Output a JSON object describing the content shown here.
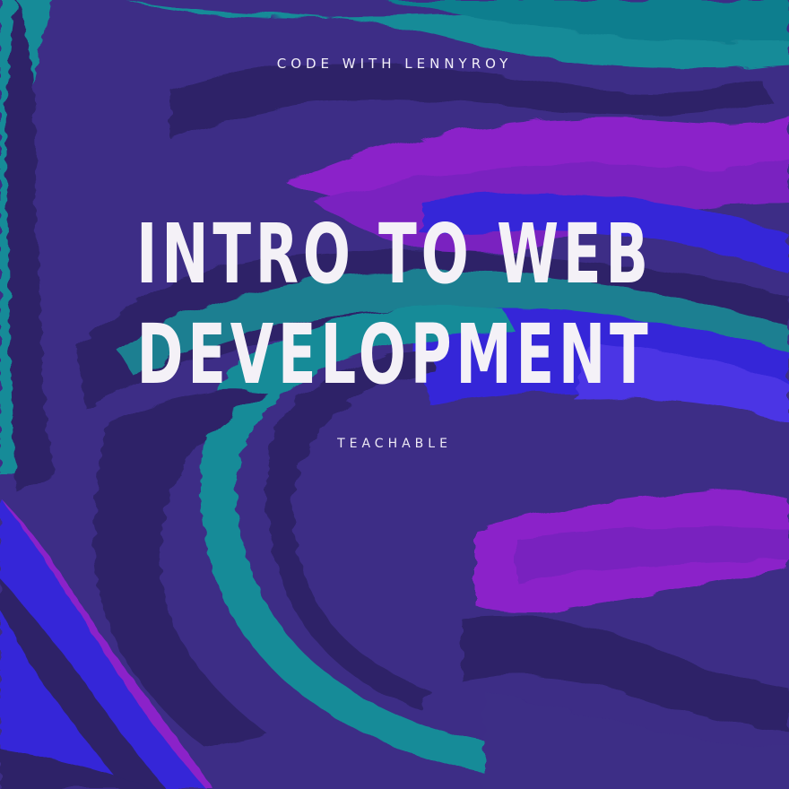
{
  "cover": {
    "eyebrow": "CODE WITH LENNYROY",
    "title_line_1": "INTRO TO WEB",
    "title_line_2": "DEVELOPMENT",
    "subtitle": "TEACHABLE"
  },
  "colors": {
    "background": "#3d2d86",
    "teal": "#158b98",
    "purple": "#8b21c9",
    "blue": "#3428d8",
    "dark": "#2d2468",
    "text": "#f4f1f7"
  },
  "icons": {
    "background": "abstract-brushstroke-art"
  }
}
